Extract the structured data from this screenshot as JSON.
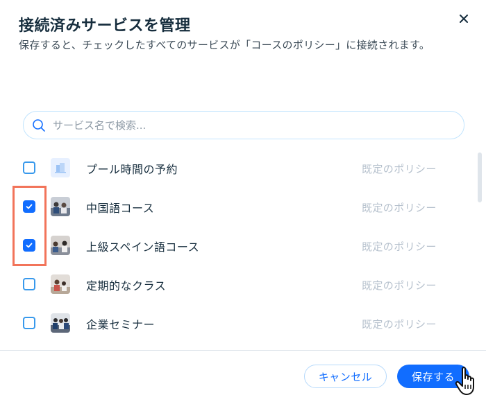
{
  "dialog": {
    "title": "接続済みサービスを管理",
    "subtitle": "保存すると、チェックしたすべてのサービスが「コースのポリシー」に接続されます。",
    "close_icon": "close-icon"
  },
  "search": {
    "placeholder": "サービス名で検索...",
    "value": "",
    "icon": "search-icon"
  },
  "services": [
    {
      "name": "プール時間の予約",
      "policy": "既定のポリシー",
      "checked": false,
      "thumb": "building-icon"
    },
    {
      "name": "中国語コース",
      "policy": "既定のポリシー",
      "checked": true,
      "thumb": "class-photo"
    },
    {
      "name": "上級スペイン語コース",
      "policy": "既定のポリシー",
      "checked": true,
      "thumb": "class-photo"
    },
    {
      "name": "定期的なクラス",
      "policy": "既定のポリシー",
      "checked": false,
      "thumb": "class-photo"
    },
    {
      "name": "企業セミナー",
      "policy": "既定のポリシー",
      "checked": false,
      "thumb": "seminar-photo"
    }
  ],
  "footer": {
    "cancel_label": "キャンセル",
    "save_label": "保存する"
  },
  "colors": {
    "accent": "#116dff",
    "highlight": "#f2745a",
    "muted_text": "#b6c1cd"
  }
}
